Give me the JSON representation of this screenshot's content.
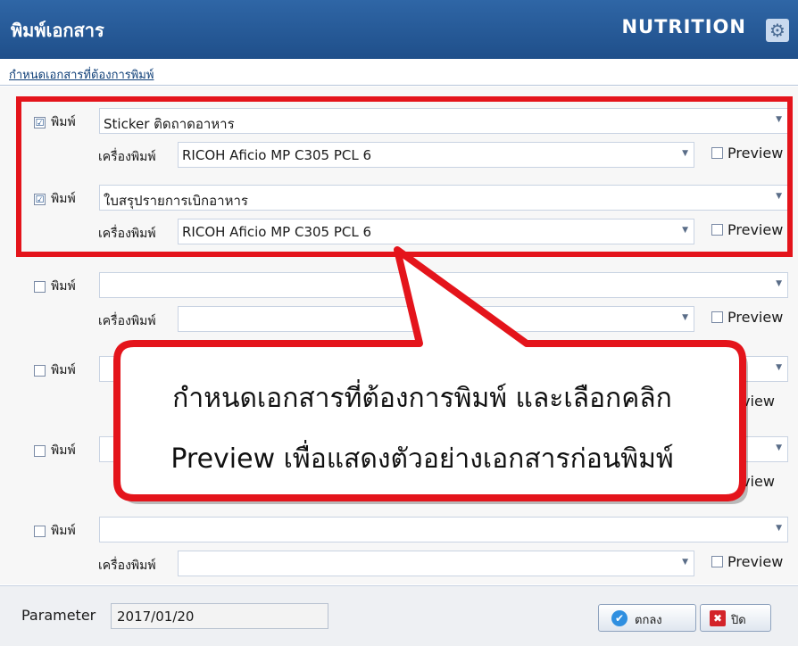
{
  "window": {
    "title": "พิมพ์เอกสาร",
    "module": "NUTRITION",
    "gear_icon": "gear-icon"
  },
  "subheader": {
    "label": "กำหนดเอกสารที่ต้องการพิมพ์"
  },
  "rows": [
    {
      "checked": true,
      "check_mark": "☑",
      "print_label": "พิมพ์",
      "document": "Sticker ติดถาดอาหาร",
      "printer_label": "เครื่องพิมพ์",
      "printer": "RICOH Aficio MP C305 PCL 6",
      "preview_label": "Preview"
    },
    {
      "checked": true,
      "check_mark": "☑",
      "print_label": "พิมพ์",
      "document": "ใบสรุปรายการเบิกอาหาร",
      "printer_label": "เครื่องพิมพ์",
      "printer": "RICOH Aficio MP C305 PCL 6",
      "preview_label": "Preview"
    },
    {
      "checked": false,
      "check_mark": "",
      "print_label": "พิมพ์",
      "document": "",
      "printer_label": "เครื่องพิมพ์",
      "printer": "",
      "preview_label": "Preview"
    },
    {
      "checked": false,
      "check_mark": "",
      "print_label": "พิมพ์",
      "document": "",
      "printer_label": "",
      "printer": "",
      "preview_label": "review"
    },
    {
      "checked": false,
      "check_mark": "",
      "print_label": "พิมพ์",
      "document": "",
      "printer_label": "",
      "printer": "",
      "preview_label": "review"
    },
    {
      "checked": false,
      "check_mark": "",
      "print_label": "พิมพ์",
      "document": "",
      "printer_label": "เครื่องพิมพ์",
      "printer": "",
      "preview_label": "Preview"
    }
  ],
  "callout": {
    "line1": "กำหนดเอกสารที่ต้องการพิมพ์ และเลือกคลิก",
    "line2": "Preview เพื่อแสดงตัวอย่างเอกสารก่อนพิมพ์",
    "color": "#e4141b"
  },
  "footer": {
    "parameter_label": "Parameter",
    "parameter_value": "2017/01/20",
    "ok_label": "ตกลง",
    "close_label": "ปิด"
  }
}
